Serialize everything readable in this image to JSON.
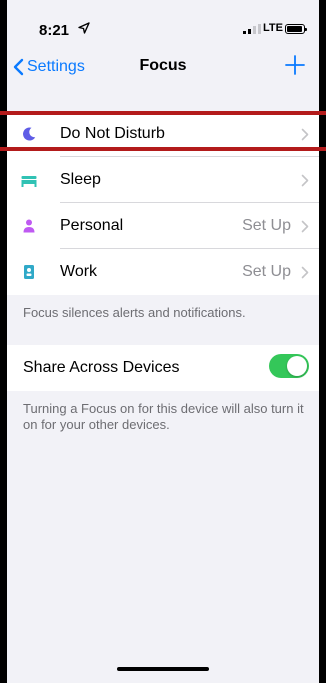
{
  "status_bar": {
    "time": "8:21",
    "network": "LTE"
  },
  "nav": {
    "back_label": "Settings",
    "title": "Focus",
    "add_icon": "plus-icon"
  },
  "focus_items": [
    {
      "label": "Do Not Disturb",
      "value": "",
      "icon": "moon-icon",
      "color": "#5e5ce6"
    },
    {
      "label": "Sleep",
      "value": "",
      "icon": "bed-icon",
      "color": "#30c2b4"
    },
    {
      "label": "Personal",
      "value": "Set Up",
      "icon": "person-icon",
      "color": "#bf5af2"
    },
    {
      "label": "Work",
      "value": "Set Up",
      "icon": "work-id-icon",
      "color": "#30a9c8"
    }
  ],
  "focus_footer": "Focus silences alerts and notifications.",
  "share": {
    "label": "Share Across Devices",
    "enabled": true,
    "color": "#34c759"
  },
  "share_footer": "Turning a Focus on for this device will also turn it on for your other devices.",
  "highlight_color": "#b31b1b",
  "accent_color": "#0a7aff"
}
